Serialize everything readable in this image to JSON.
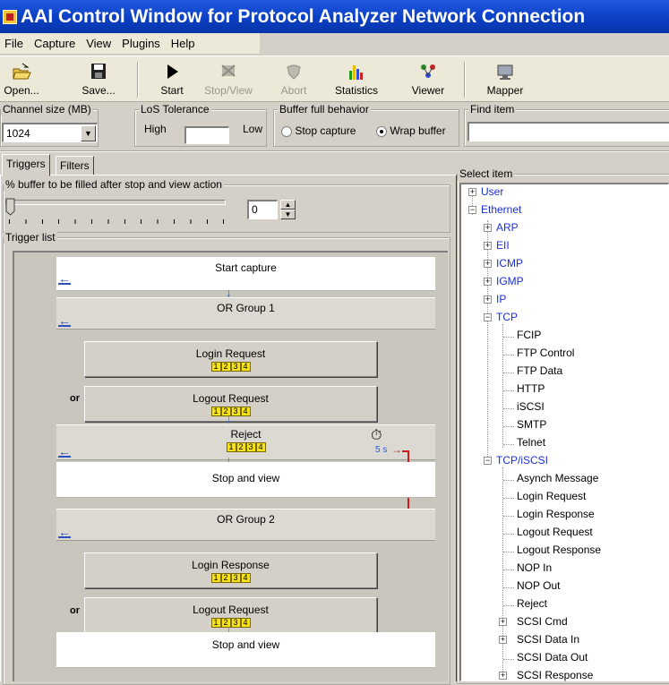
{
  "window": {
    "title": "AAI Control Window for Protocol Analyzer  Network Connection"
  },
  "menu": [
    "File",
    "Capture",
    "View",
    "Plugins",
    "Help"
  ],
  "toolbar": {
    "open": "Open...",
    "save": "Save...",
    "start": "Start",
    "stopview": "Stop/View",
    "abort": "Abort",
    "statistics": "Statistics",
    "viewer": "Viewer",
    "mapper": "Mapper"
  },
  "channel": {
    "label": "Channel size (MB)",
    "value": "1024"
  },
  "los": {
    "label": "LoS Tolerance",
    "high": "High",
    "low": "Low"
  },
  "buffer": {
    "label": "Buffer full behavior",
    "stop": "Stop capture",
    "wrap": "Wrap buffer",
    "selected": "wrap"
  },
  "find": {
    "label": "Find item",
    "value": ""
  },
  "tabs": {
    "triggers": "Triggers",
    "filters": "Filters"
  },
  "percent": {
    "label": "% buffer to be filled after stop and view action",
    "value": "0"
  },
  "trigger_list": {
    "label": "Trigger list",
    "or": "or",
    "start_capture": "Start capture",
    "or_group_1": "OR Group 1",
    "login_request": "Login Request",
    "logout_request": "Logout Request",
    "reject": "Reject",
    "timer": "5 s",
    "stop_and_view": "Stop and view",
    "or_group_2": "OR Group 2",
    "login_response": "Login Response",
    "logout_request_2": "Logout Request",
    "stop_and_view_2": "Stop and view",
    "nums": [
      "1",
      "2",
      "3",
      "4"
    ]
  },
  "select_item": {
    "label": "Select item",
    "items": [
      {
        "label": "User",
        "blue": true
      },
      {
        "label": "Ethernet",
        "blue": true
      },
      {
        "label": "ARP",
        "blue": true
      },
      {
        "label": "EII",
        "blue": true
      },
      {
        "label": "ICMP",
        "blue": true
      },
      {
        "label": "IGMP",
        "blue": true
      },
      {
        "label": "IP",
        "blue": true
      },
      {
        "label": "TCP",
        "blue": true
      },
      {
        "label": "FCIP",
        "blue": false
      },
      {
        "label": "FTP Control",
        "blue": false
      },
      {
        "label": "FTP Data",
        "blue": false
      },
      {
        "label": "HTTP",
        "blue": false
      },
      {
        "label": "iSCSI",
        "blue": false
      },
      {
        "label": "SMTP",
        "blue": false
      },
      {
        "label": "Telnet",
        "blue": false
      },
      {
        "label": "TCP/iSCSI",
        "blue": true
      },
      {
        "label": "Asynch Message",
        "blue": false
      },
      {
        "label": "Login Request",
        "blue": false
      },
      {
        "label": "Login Response",
        "blue": false
      },
      {
        "label": "Logout Request",
        "blue": false
      },
      {
        "label": "Logout Response",
        "blue": false
      },
      {
        "label": "NOP In",
        "blue": false
      },
      {
        "label": "NOP Out",
        "blue": false
      },
      {
        "label": "Reject",
        "blue": false
      },
      {
        "label": "SCSI Cmd",
        "blue": false
      },
      {
        "label": "SCSI Data In",
        "blue": false
      },
      {
        "label": "SCSI Data Out",
        "blue": false
      },
      {
        "label": "SCSI Response",
        "blue": false
      }
    ]
  }
}
